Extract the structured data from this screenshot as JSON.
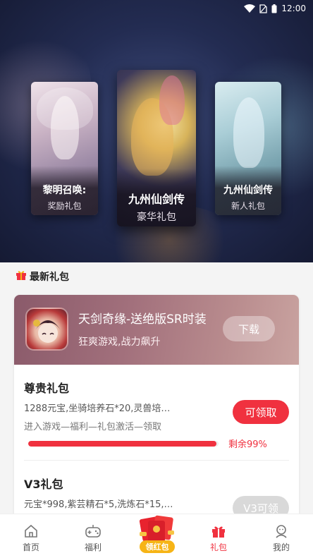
{
  "status_bar": {
    "time": "12:00"
  },
  "featured": [
    {
      "title": "黎明召唤:",
      "subtitle": "奖励礼包"
    },
    {
      "title": "九州仙剑传",
      "subtitle": "豪华礼包"
    },
    {
      "title": "九州仙剑传",
      "subtitle": "新人礼包"
    }
  ],
  "section": {
    "title": "最新礼包"
  },
  "game": {
    "title": "天剑奇缘-送绝版SR时装",
    "subtitle": "狂爽游戏,战力飙升",
    "download_label": "下载"
  },
  "gifts": [
    {
      "name": "尊贵礼包",
      "desc": "1288元宝,坐骑培养石*20,灵兽培…",
      "how": "进入游戏—福利—礼包激活—领取",
      "button": "可领取",
      "remaining_percent": 99,
      "remaining_label": "剩余99%"
    },
    {
      "name": "V3礼包",
      "desc": "元宝*998,紫芸精石*5,洗炼石*15,…",
      "button": "V3可领"
    }
  ],
  "nav": {
    "home": "首页",
    "welfare": "福利",
    "red_packet": "领红包",
    "gift": "礼包",
    "mine": "我的"
  },
  "colors": {
    "accent": "#f0313f",
    "gold": "#f6b416"
  }
}
